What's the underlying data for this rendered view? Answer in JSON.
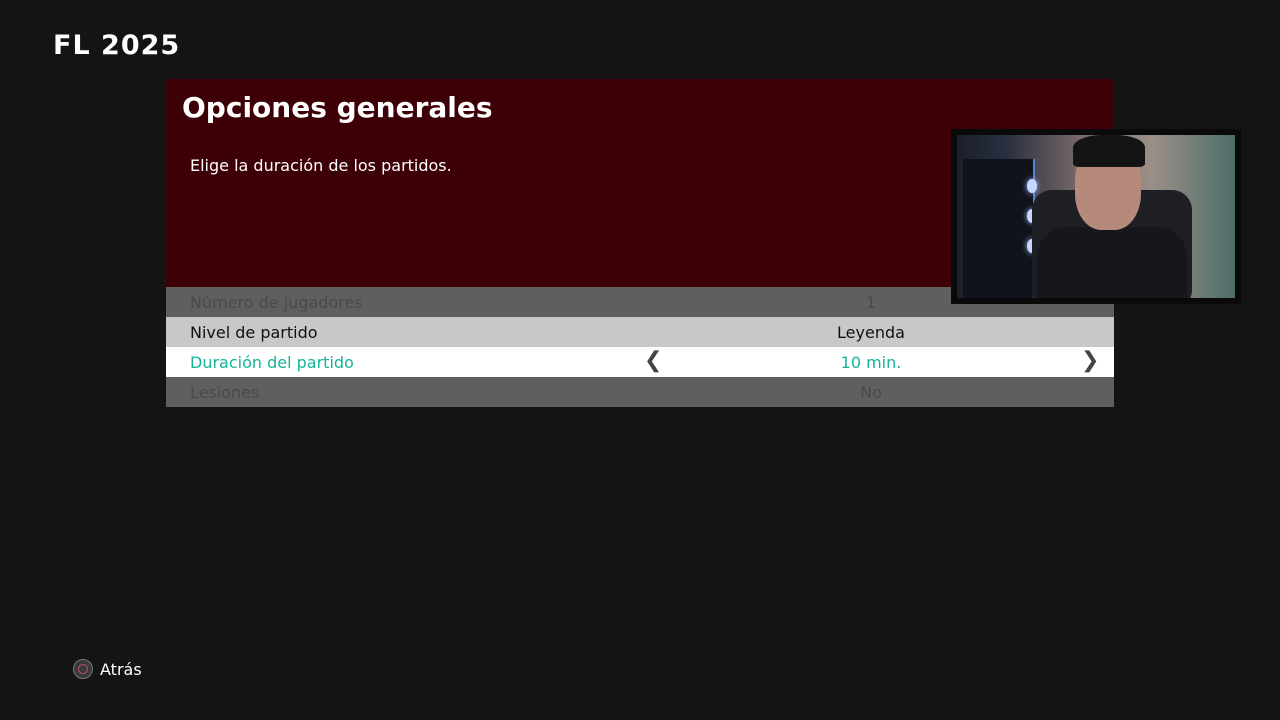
{
  "logo": "FL 2025",
  "panel": {
    "title": "Opciones generales",
    "description": "Elige la duración de los partidos."
  },
  "options": [
    {
      "label": "Número de jugadores",
      "value": "1",
      "state": "disabled"
    },
    {
      "label": "Nivel de partido",
      "value": "Leyenda",
      "state": "normal"
    },
    {
      "label": "Duración del partido",
      "value": "10 min.",
      "state": "selected"
    },
    {
      "label": "Lesiones",
      "value": "No",
      "state": "disabled"
    }
  ],
  "arrows": {
    "left": "❮",
    "right": "❯"
  },
  "footer": {
    "back_label": "Atrás",
    "back_icon": "circle-button-icon"
  },
  "colors": {
    "background": "#141414",
    "panel": "#3d0006",
    "selected_text": "#16b39a"
  }
}
